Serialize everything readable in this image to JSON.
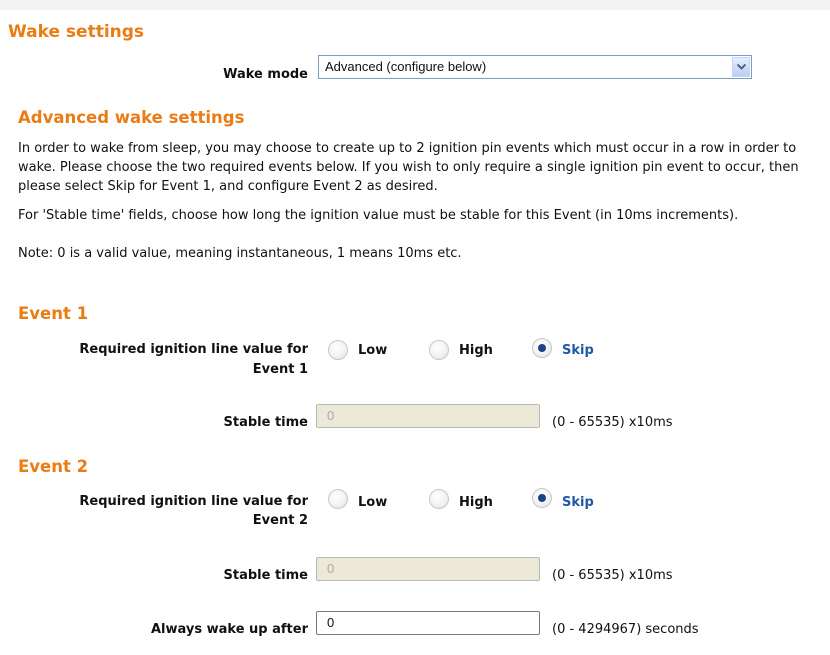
{
  "section_title": "Wake settings",
  "wake_mode": {
    "label": "Wake mode",
    "selected": "Advanced (configure below)"
  },
  "advanced": {
    "title": "Advanced wake settings",
    "para1": "In order to wake from sleep, you may choose to create up to 2 ignition pin events which must occur in a row in order to wake. Please choose the two required events below. If you wish to only require a single ignition pin event to occur, then please select Skip for Event 1, and configure Event 2 as desired.",
    "para2_line1": "For 'Stable time' fields, choose how long the ignition value must be stable for this Event (in 10ms increments).",
    "para2_line2": "Note: 0 is a valid value, meaning instantaneous, 1 means 10ms etc."
  },
  "event1": {
    "title": "Event 1",
    "label_line1": "Required ignition line value for",
    "label_line2": "Event 1",
    "options": [
      "Low",
      "High",
      "Skip"
    ],
    "selected": "Skip",
    "stable_label": "Stable time",
    "stable_value": "0",
    "stable_range": "(0 - 65535)  x10ms"
  },
  "event2": {
    "title": "Event 2",
    "label_line1": "Required ignition line value for",
    "label_line2": "Event 2",
    "options": [
      "Low",
      "High",
      "Skip"
    ],
    "selected": "Skip",
    "stable_label": "Stable time",
    "stable_value": "0",
    "stable_range": "(0 - 65535)  x10ms"
  },
  "always_wake": {
    "label": "Always wake up after",
    "value": "0",
    "range": "(0 - 4294967)  seconds"
  },
  "colors": {
    "heading": "#ea7c14",
    "selected_option": "#1f5aa6",
    "radio_dot": "#1b3f8b"
  }
}
